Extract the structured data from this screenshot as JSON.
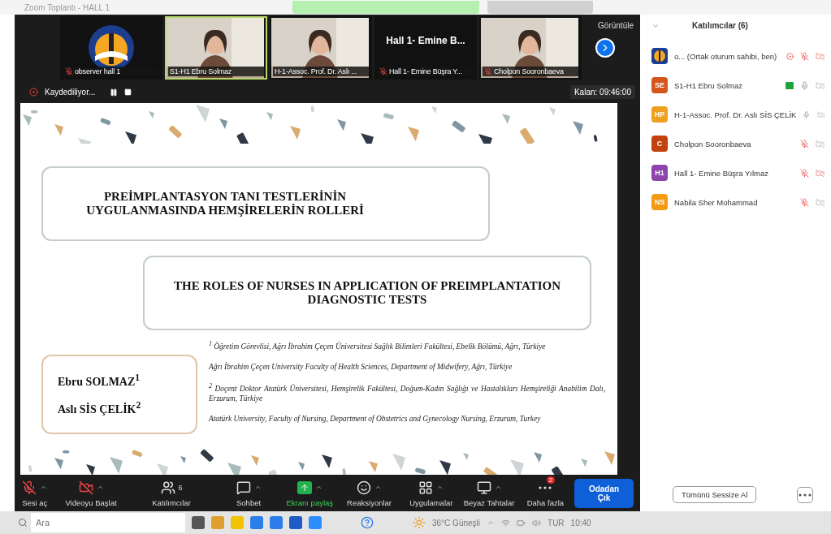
{
  "window": {
    "title": "Zoom Toplantı - HALL 1"
  },
  "video_strip": {
    "view_label": "Görüntüle",
    "tiles": [
      {
        "kind": "logo",
        "name": "observer hall 1",
        "muted": true,
        "selected": false
      },
      {
        "kind": "video",
        "name": "S1-H1 Ebru Solmaz",
        "muted": false,
        "selected": true
      },
      {
        "kind": "video",
        "name": "H-1-Assoc. Prof. Dr. Aslı ...",
        "muted": false,
        "selected": false
      },
      {
        "kind": "text",
        "display": "Hall 1- Emine B...",
        "name": "Hall 1- Emine Büşra Y...",
        "muted": true,
        "selected": false
      },
      {
        "kind": "video",
        "name": "Cholpon Sooronbaeva",
        "muted": true,
        "selected": false
      }
    ]
  },
  "recording": {
    "label": "Kaydediliyor...",
    "remaining": "Kalan: 09:46:00"
  },
  "slide": {
    "title_tr": [
      "PREİMPLANTASYON TANI TESTLERİNİN",
      "UYGULANMASINDA HEMŞİRELERİN ROLLERİ"
    ],
    "title_en": [
      "THE ROLES OF NURSES IN APPLICATION OF PREIMPLANTATION",
      "DIAGNOSTIC TESTS"
    ],
    "authors": [
      "Ebru SOLMAZ$^{1}$",
      "Aslı SİS ÇELİK$^{2}$"
    ],
    "affiliations": [
      "$^{1}$ Öğretim Görevlisi, Ağrı İbrahim Çeçen Üniversitesi Sağlık Bilimleri Fakültesi, Ebelik Bölümü, Ağrı, Türkiye",
      "Ağrı İbrahim Çeçen University Faculty of Health Sciences, Department of Midwifery, Ağrı, Türkiye",
      "$^{2}$ Doçent Doktor Atatürk Üniversitesi, Hemşirelik Fakültesi, Doğum-Kadın Sağlığı ve Hastalıkları Hemşireliği Anabilim Dalı, Erzurum, Türkiye",
      "Atatürk University, Faculty of Nursing, Department of Obstetrics and Gynecology Nursing, Erzurum, Turkey"
    ]
  },
  "toolbar": {
    "items": [
      {
        "kind": "mic",
        "label": "Sesi aç",
        "crossed": true,
        "caret": true
      },
      {
        "kind": "video",
        "label": "Videoyu Başlat",
        "crossed": true,
        "caret": true
      },
      {
        "kind": "participants",
        "label": "Katılımcılar",
        "badge": "6",
        "caret": false
      },
      {
        "kind": "chat",
        "label": "Sohbet",
        "caret": true
      },
      {
        "kind": "share",
        "label": "Ekranı paylaş",
        "caret": true
      },
      {
        "kind": "reactions",
        "label": "Reaksiyonlar",
        "caret": true
      },
      {
        "kind": "apps",
        "label": "Uygulamalar",
        "caret": true
      },
      {
        "kind": "whiteboard",
        "label": "Beyaz Tahtalar",
        "caret": true
      },
      {
        "kind": "more",
        "label": "Daha fazla",
        "badge": "2",
        "caret": false
      }
    ],
    "leave": "Odadan Çık"
  },
  "participants_panel": {
    "title": "Katılımcılar (6)",
    "people": [
      {
        "kind": "logo",
        "name": "o... (Ortak oturum sahibi, ben)",
        "recording": true,
        "sharing": false,
        "muted": true,
        "video_red": true
      },
      {
        "kind": "initials",
        "initials": "SE",
        "color": "#d4561c",
        "name": "S1-H1 Ebru Solmaz",
        "recording": false,
        "sharing": true,
        "muted": false,
        "video_red": false
      },
      {
        "kind": "initials",
        "initials": "HP",
        "color": "#f0a020",
        "name": "H-1-Assoc. Prof. Dr. Aslı SİS ÇELİK",
        "recording": false,
        "sharing": false,
        "muted": false,
        "video_red": false
      },
      {
        "kind": "initials",
        "initials": "C",
        "color": "#c2410c",
        "name": "Cholpon Sooronbaeva",
        "recording": false,
        "sharing": false,
        "muted": true,
        "video_red": false
      },
      {
        "kind": "initials",
        "initials": "H1",
        "color": "#8e44ad",
        "name": "Hall 1- Emine Büşra Yılmaz",
        "recording": false,
        "sharing": false,
        "muted": true,
        "video_red": true
      },
      {
        "kind": "initials",
        "initials": "NS",
        "color": "#f39c12",
        "name": "Nabila Sher Mohammad",
        "recording": false,
        "sharing": false,
        "muted": true,
        "video_red": false
      }
    ],
    "mute_all": "Tümünü Sessize Al"
  },
  "taskbar": {
    "search_placeholder": "Ara",
    "weather": "36°C Güneşli",
    "language": "TUR",
    "time": "10:40"
  }
}
